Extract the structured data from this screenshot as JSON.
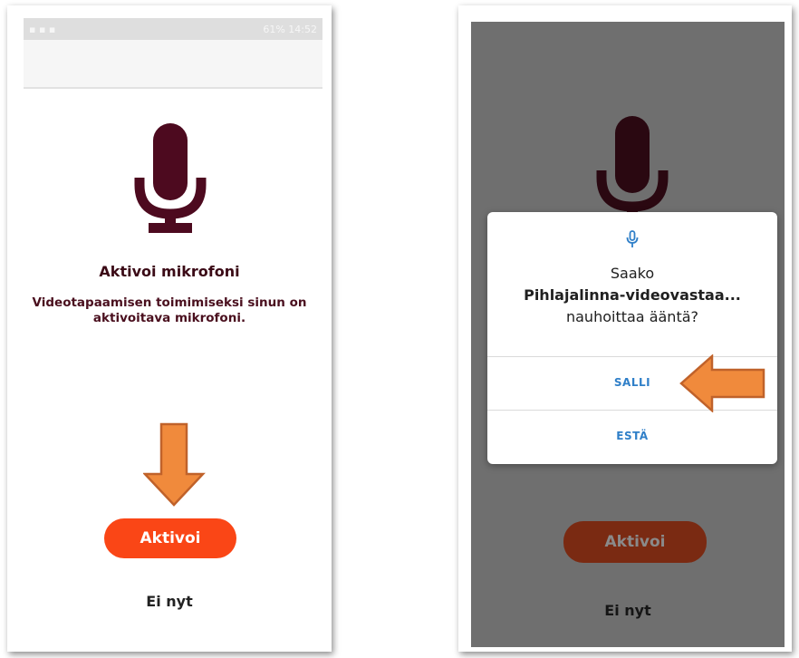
{
  "left_screen": {
    "status_time": "14:52",
    "status_battery": "61%",
    "heading": "Aktivoi mikrofoni",
    "description_line1": "Videotapaamisen toimimiseksi sinun on",
    "description_line2": "aktivoitava mikrofoni.",
    "activate_button": "Aktivoi",
    "not_now": "Ei nyt"
  },
  "right_screen": {
    "permission_dialog": {
      "line1": "Saako",
      "app_name": "Pihlajalinna-videovastaa...",
      "line3": "nauhoittaa ääntä?",
      "allow_button": "SALLI",
      "deny_button": "ESTÄ"
    },
    "activate_button": "Aktivoi",
    "not_now": "Ei nyt"
  },
  "colors": {
    "mic": "#4d0a1f",
    "mic_dimmed": "#2a0811",
    "button": "#fa4616",
    "button_dimmed": "#7a2a12",
    "dialog_accent": "#2f7fc8",
    "arrow_fill": "#f08a3c",
    "arrow_stroke": "#c0622a"
  },
  "icons": [
    "microphone-icon",
    "down-arrow-callout",
    "left-arrow-callout"
  ]
}
